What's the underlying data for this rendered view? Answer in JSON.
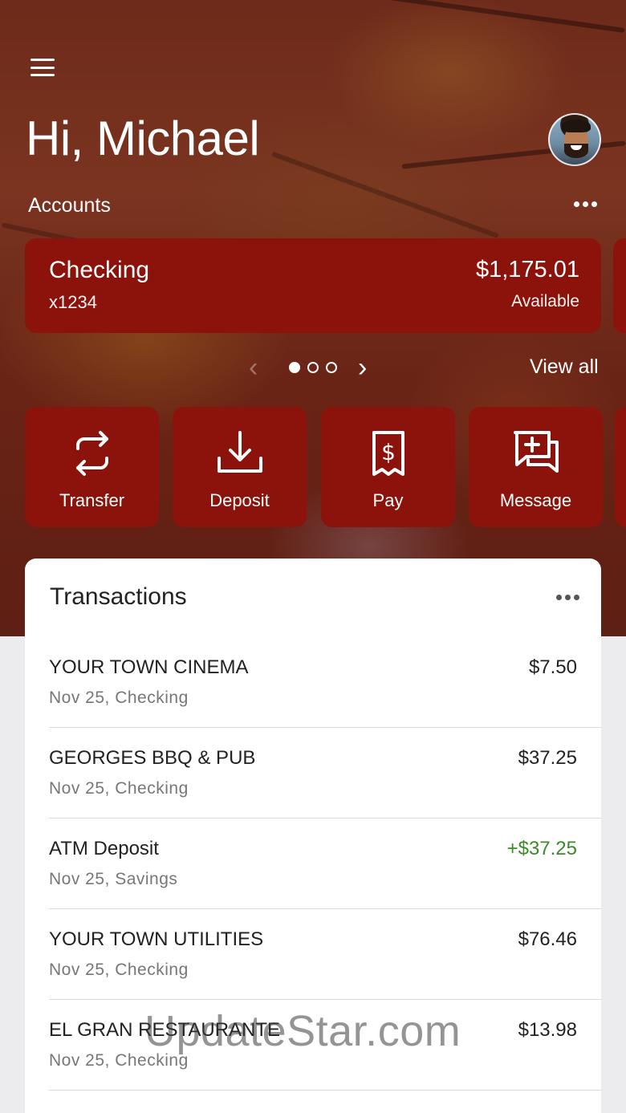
{
  "header": {
    "greeting": "Hi, Michael",
    "accounts_label": "Accounts",
    "menu_icon": "hamburger-icon",
    "avatar_icon": "user-avatar"
  },
  "account": {
    "name": "Checking",
    "number": "x1234",
    "balance": "$1,175.01",
    "balance_label": "Available"
  },
  "carousel": {
    "page_count": 3,
    "current_page": 1,
    "view_all_label": "View all"
  },
  "actions": [
    {
      "label": "Transfer",
      "icon": "transfer-icon"
    },
    {
      "label": "Deposit",
      "icon": "deposit-icon"
    },
    {
      "label": "Pay",
      "icon": "pay-bill-icon"
    },
    {
      "label": "Message",
      "icon": "message-icon"
    }
  ],
  "transactions": {
    "title": "Transactions",
    "items": [
      {
        "merchant": "YOUR TOWN CINEMA",
        "detail": "Nov 25, Checking",
        "amount": "$7.50",
        "credit": false
      },
      {
        "merchant": "GEORGES BBQ & PUB",
        "detail": "Nov 25, Checking",
        "amount": "$37.25",
        "credit": false
      },
      {
        "merchant": "ATM Deposit",
        "detail": "Nov 25, Savings",
        "amount": "+$37.25",
        "credit": true
      },
      {
        "merchant": "YOUR TOWN UTILITIES",
        "detail": "Nov 25, Checking",
        "amount": "$76.46",
        "credit": false
      },
      {
        "merchant": "EL GRAN RESTAURANTE",
        "detail": "Nov 25, Checking",
        "amount": "$13.98",
        "credit": false
      }
    ]
  },
  "colors": {
    "brand_red": "#8c130b",
    "credit_green": "#3a8a2a"
  },
  "watermark": "UpdateStar.com"
}
